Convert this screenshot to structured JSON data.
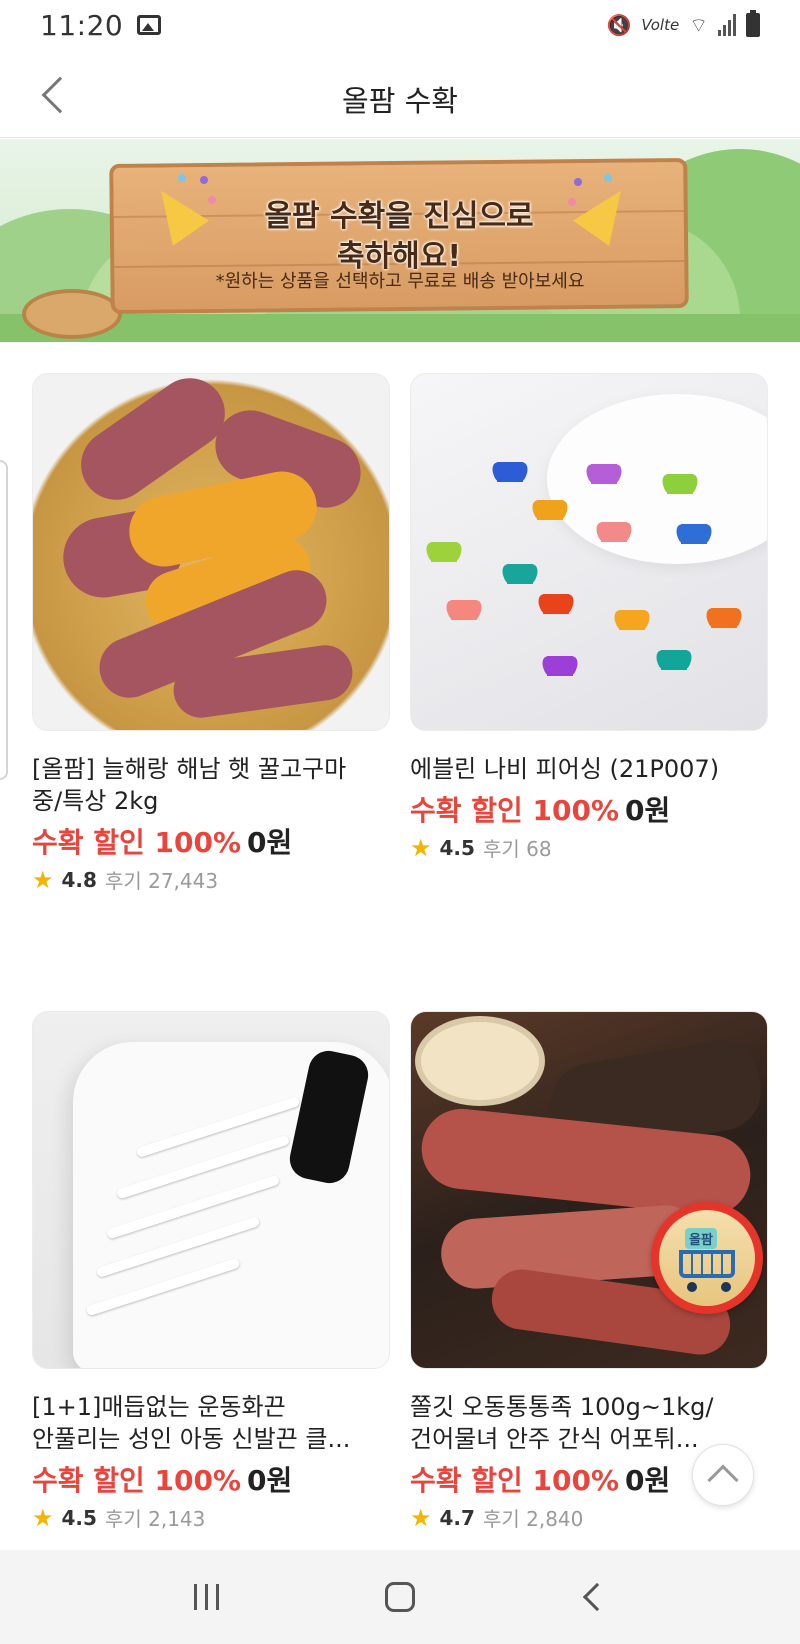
{
  "status_bar": {
    "time": "11:20",
    "network": "Volte"
  },
  "header": {
    "title": "올팜 수확"
  },
  "banner": {
    "title_line1": "올팜 수확을 진심으로",
    "title_line2": "축하해요!",
    "subtitle": "*원하는 상품을 선택하고 무료로 배송 받아보세요"
  },
  "products": [
    {
      "name_line1": "[올팜] 늘해랑 해남 햇 꿀고구마",
      "name_line2": "중/특상 2kg",
      "discount": "수확 할인 100%",
      "price": "0원",
      "rating": "4.8",
      "reviews": "후기 27,443"
    },
    {
      "name_line1": "에블린 나비 피어싱 (21P007)",
      "name_line2": "",
      "discount": "수확 할인 100%",
      "price": "0원",
      "rating": "4.5",
      "reviews": "후기 68"
    },
    {
      "name_line1": "[1+1]매듭없는 운동화끈",
      "name_line2": "안풀리는 성인 아동 신발끈 클...",
      "discount": "수확 할인 100%",
      "price": "0원",
      "rating": "4.5",
      "reviews": "후기 2,143"
    },
    {
      "name_line1": "쫄깃 오동통통족 100g~1kg/",
      "name_line2": "건어물녀 안주 간식 어포튀...",
      "discount": "수확 할인 100%",
      "price": "0원",
      "rating": "4.7",
      "reviews": "후기 2,840"
    }
  ],
  "cart_button": {
    "label": "올팜"
  },
  "icons": {
    "back": "chevron-left-icon",
    "star": "star-icon",
    "scroll_top": "chevron-up-icon",
    "cart": "shopping-cart-icon"
  },
  "colors": {
    "discount": "#e8453c",
    "star": "#f4b400",
    "cart_ring": "#e5352a"
  }
}
